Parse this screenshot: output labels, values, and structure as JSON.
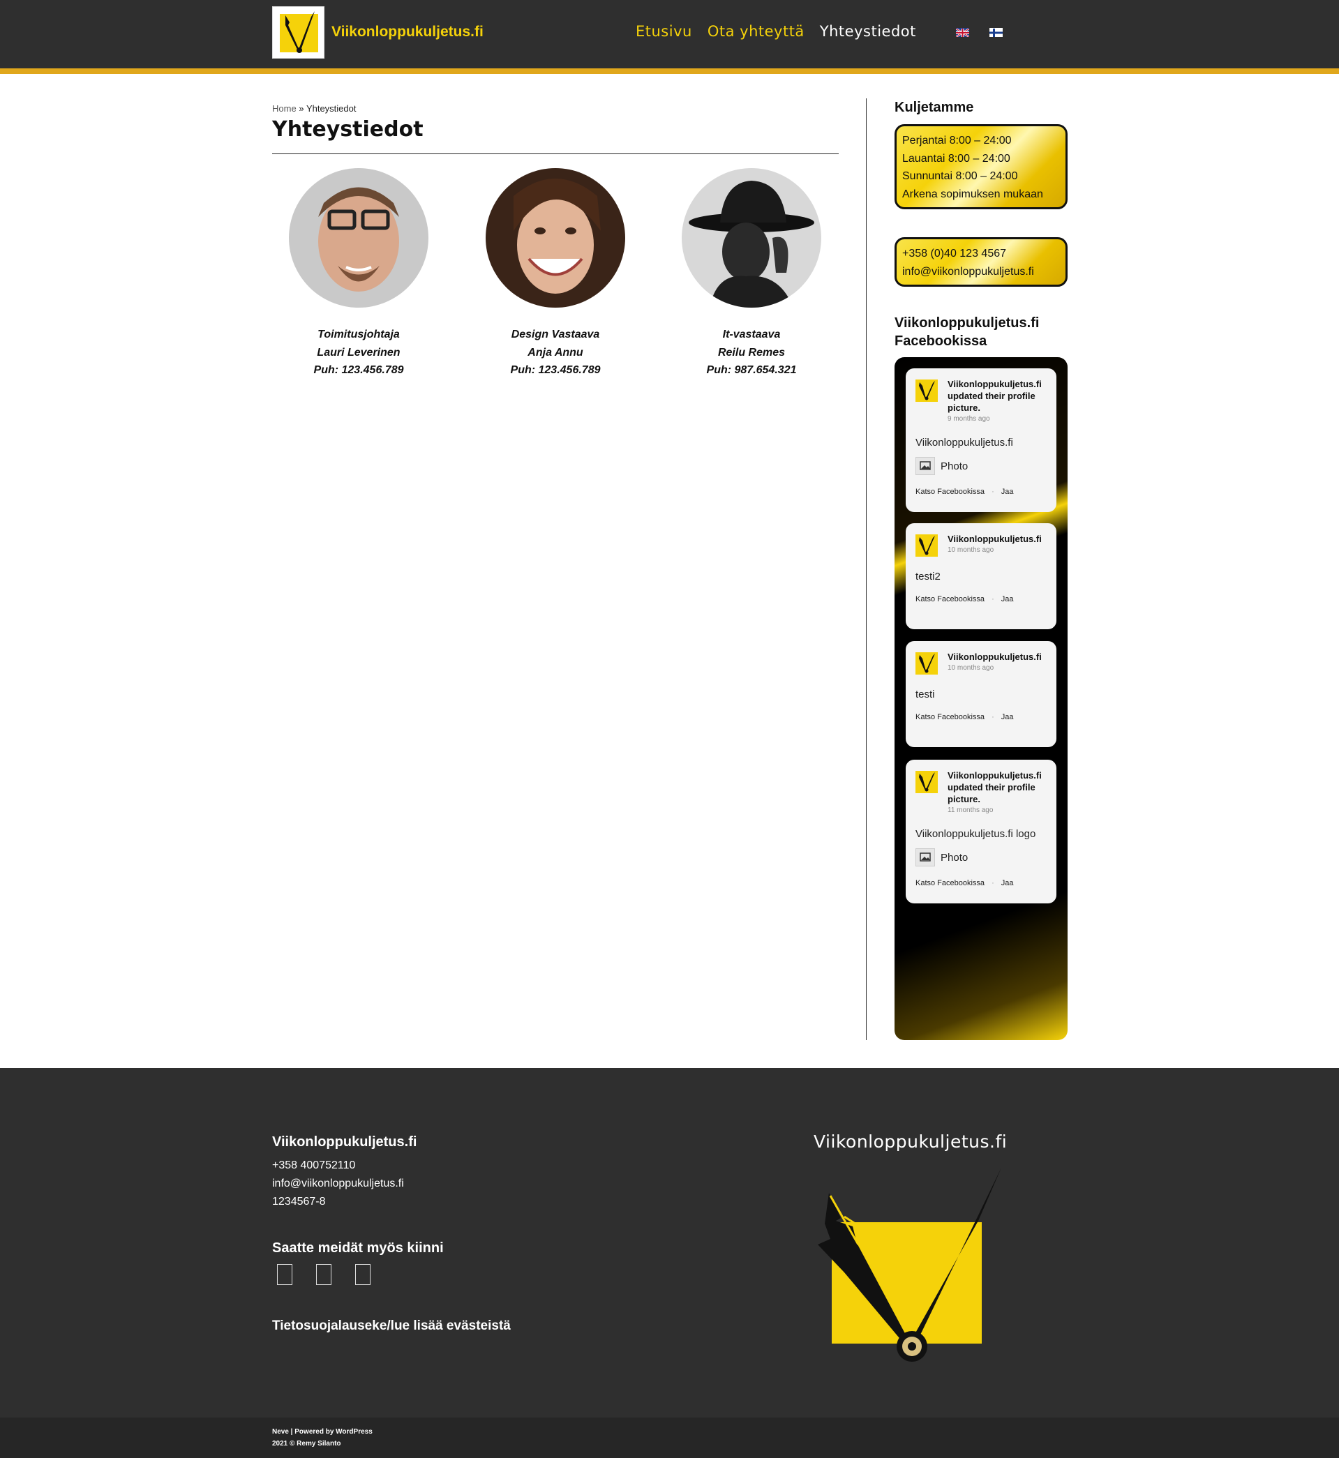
{
  "header": {
    "site_title": "Viikonloppukuljetus.fi",
    "nav": [
      {
        "label": "Etusivu"
      },
      {
        "label": "Ota yhteyttä"
      },
      {
        "label": "Yhteystiedot"
      }
    ],
    "languages": [
      "en-flag-icon",
      "fi-flag-icon"
    ],
    "accent_color": "#f5d20a",
    "bar_color": "#e0a71c"
  },
  "breadcrumb": {
    "home": "Home",
    "separator": "»",
    "current": "Yhteystiedot"
  },
  "page_title": "Yhteystiedot",
  "people": [
    {
      "role": "Toimitusjohtaja",
      "name": "Lauri Leverinen",
      "phone": "Puh: 123.456.789"
    },
    {
      "role": "Design Vastaava",
      "name": "Anja Annu",
      "phone": "Puh: 123.456.789"
    },
    {
      "role": "It-vastaava",
      "name": "Reilu Remes",
      "phone": "Puh: 987.654.321"
    }
  ],
  "sidebar": {
    "hours_title": "Kuljetamme",
    "hours": [
      "Perjantai 8:00 – 24:00",
      "Lauantai 8:00 – 24:00",
      "Sunnuntai 8:00 – 24:00",
      "Arkena sopimuksen mukaan"
    ],
    "contact": [
      "+358 (0)40 123 4567",
      "info@viikonloppukuljetus.fi"
    ],
    "fb_title_1": "Viikonloppukuljetus.fi",
    "fb_title_2": "Facebookissa",
    "fb_posts": [
      {
        "name": "Viikonloppukuljetus.fi updated their profile picture.",
        "time": "9 months ago",
        "body": "Viikonloppukuljetus.fi",
        "photo": "Photo",
        "view": "Katso Facebookissa",
        "share": "Jaa"
      },
      {
        "name": "Viikonloppukuljetus.fi",
        "time": "10 months ago",
        "body": "testi2",
        "view": "Katso Facebookissa",
        "share": "Jaa"
      },
      {
        "name": "Viikonloppukuljetus.fi",
        "time": "10 months ago",
        "body": "testi",
        "view": "Katso Facebookissa",
        "share": "Jaa"
      },
      {
        "name": "Viikonloppukuljetus.fi updated their profile picture.",
        "time": "11 months ago",
        "body": "Viikonloppukuljetus.fi logo",
        "photo": "Photo",
        "view": "Katso Facebookissa",
        "share": "Jaa"
      }
    ]
  },
  "footer": {
    "company": "Viikonloppukuljetus.fi",
    "phone": "+358 400752110",
    "email": "info@viikonloppukuljetus.fi",
    "business_id": "1234567-8",
    "social_title": "Saatte meidät myös kiinni",
    "social_icons": [
      "facebook-icon",
      "instagram-icon",
      "twitter-icon"
    ],
    "privacy": "Tietosuojalauseke/lue lisää evästeistä",
    "brand": "Viikonloppukuljetus.fi",
    "credits_1": "Neve | Powered by WordPress",
    "credits_2": "2021 © Remy Silanto"
  }
}
